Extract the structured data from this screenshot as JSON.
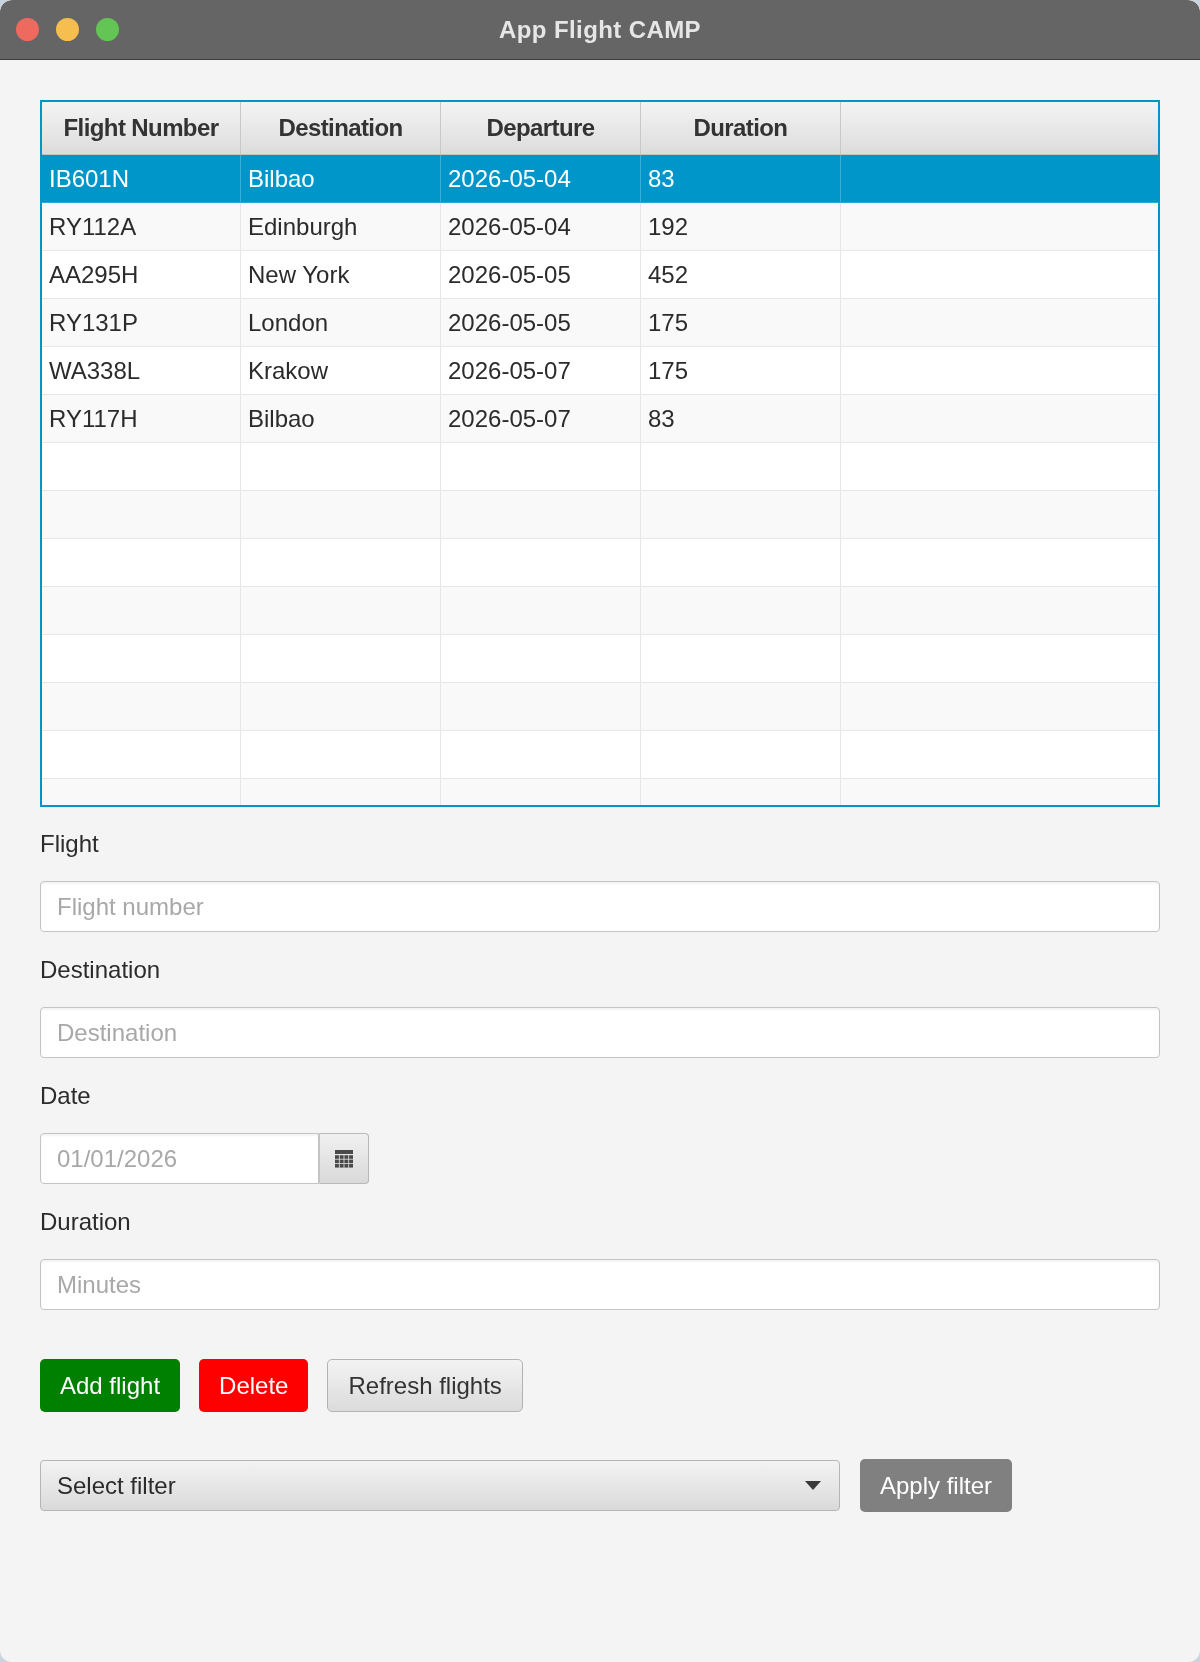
{
  "window": {
    "title": "App Flight CAMP"
  },
  "table": {
    "columns": [
      "Flight Number",
      "Destination",
      "Departure",
      "Duration"
    ],
    "rows": [
      {
        "cells": [
          "IB601N",
          "Bilbao",
          "2026-05-04",
          "83"
        ],
        "selected": true
      },
      {
        "cells": [
          "RY112A",
          "Edinburgh",
          "2026-05-04",
          "192"
        ],
        "selected": false
      },
      {
        "cells": [
          "AA295H",
          "New York",
          "2026-05-05",
          "452"
        ],
        "selected": false
      },
      {
        "cells": [
          "RY131P",
          "London",
          "2026-05-05",
          "175"
        ],
        "selected": false
      },
      {
        "cells": [
          "WA338L",
          "Krakow",
          "2026-05-07",
          "175"
        ],
        "selected": false
      },
      {
        "cells": [
          "RY117H",
          "Bilbao",
          "2026-05-07",
          "83"
        ],
        "selected": false
      }
    ]
  },
  "form": {
    "fields": [
      {
        "kind": "text",
        "label": "Flight",
        "placeholder": "Flight number"
      },
      {
        "kind": "text",
        "label": "Destination",
        "placeholder": "Destination"
      },
      {
        "kind": "date",
        "label": "Date",
        "placeholder": "01/01/2026"
      },
      {
        "kind": "text",
        "label": "Duration",
        "placeholder": "Minutes"
      }
    ]
  },
  "buttons": [
    {
      "kind": "success",
      "label": "Add flight"
    },
    {
      "kind": "danger",
      "label": "Delete"
    },
    {
      "kind": "default",
      "label": "Refresh flights"
    }
  ],
  "filter": {
    "prompt": "Select filter",
    "button": {
      "kind": "neutral",
      "label": "Apply filter"
    }
  }
}
